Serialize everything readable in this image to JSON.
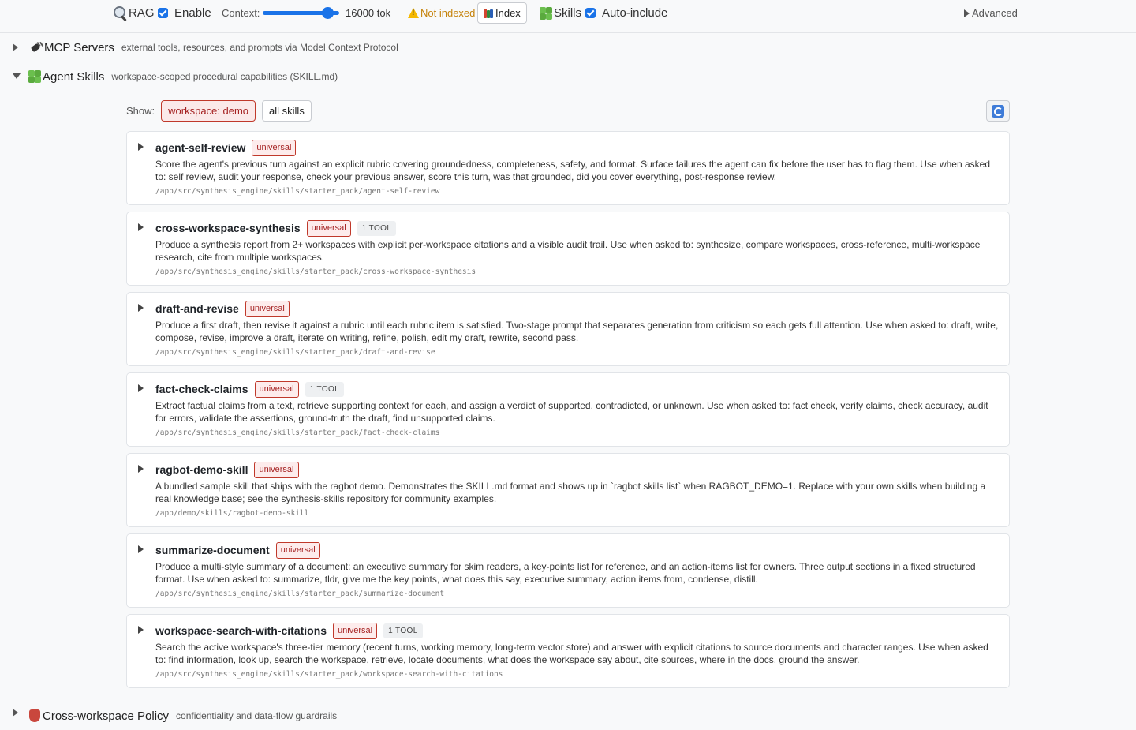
{
  "toolbar": {
    "rag_label": "RAG",
    "enable_label": "Enable",
    "context_label": "Context:",
    "context_value": "16000 tok",
    "context_fraction": 0.85,
    "index_status": "Not indexed",
    "index_button": "Index",
    "skills_label": "Skills",
    "auto_include_label": "Auto-include",
    "advanced_label": "Advanced",
    "enable_checked": true,
    "auto_include_checked": true
  },
  "sections": {
    "mcp": {
      "title": "MCP Servers",
      "desc": "external tools, resources, and prompts via Model Context Protocol",
      "expanded": false
    },
    "skills": {
      "title": "Agent Skills",
      "desc": "workspace-scoped procedural capabilities (SKILL.md)",
      "expanded": true
    },
    "policy": {
      "title": "Cross-workspace Policy",
      "desc": "confidentiality and data-flow guardrails",
      "expanded": false
    }
  },
  "filters": {
    "show_label": "Show:",
    "workspace": "workspace: demo",
    "all": "all skills",
    "active": "workspace"
  },
  "skills": [
    {
      "name": "agent-self-review",
      "badge": "universal",
      "tool": "",
      "desc": "Score the agent's previous turn against an explicit rubric covering groundedness, completeness, safety, and format. Surface failures the agent can fix before the user has to flag them. Use when asked to: self review, audit your response, check your previous answer, score this turn, was that grounded, did you cover everything, post-response review.",
      "path": "/app/src/synthesis_engine/skills/starter_pack/agent-self-review"
    },
    {
      "name": "cross-workspace-synthesis",
      "badge": "universal",
      "tool": "1 TOOL",
      "desc": "Produce a synthesis report from 2+ workspaces with explicit per-workspace citations and a visible audit trail. Use when asked to: synthesize, compare workspaces, cross-reference, multi-workspace research, cite from multiple workspaces.",
      "path": "/app/src/synthesis_engine/skills/starter_pack/cross-workspace-synthesis"
    },
    {
      "name": "draft-and-revise",
      "badge": "universal",
      "tool": "",
      "desc": "Produce a first draft, then revise it against a rubric until each rubric item is satisfied. Two-stage prompt that separates generation from criticism so each gets full attention. Use when asked to: draft, write, compose, revise, improve a draft, iterate on writing, refine, polish, edit my draft, rewrite, second pass.",
      "path": "/app/src/synthesis_engine/skills/starter_pack/draft-and-revise"
    },
    {
      "name": "fact-check-claims",
      "badge": "universal",
      "tool": "1 TOOL",
      "desc": "Extract factual claims from a text, retrieve supporting context for each, and assign a verdict of supported, contradicted, or unknown. Use when asked to: fact check, verify claims, check accuracy, audit for errors, validate the assertions, ground-truth the draft, find unsupported claims.",
      "path": "/app/src/synthesis_engine/skills/starter_pack/fact-check-claims"
    },
    {
      "name": "ragbot-demo-skill",
      "badge": "universal",
      "tool": "",
      "desc": "A bundled sample skill that ships with the ragbot demo. Demonstrates the SKILL.md format and shows up in `ragbot skills list` when RAGBOT_DEMO=1. Replace with your own skills when building a real knowledge base; see the synthesis-skills repository for community examples.",
      "path": "/app/demo/skills/ragbot-demo-skill"
    },
    {
      "name": "summarize-document",
      "badge": "universal",
      "tool": "",
      "desc": "Produce a multi-style summary of a document: an executive summary for skim readers, a key-points list for reference, and an action-items list for owners. Three output sections in a fixed structured format. Use when asked to: summarize, tldr, give me the key points, what does this say, executive summary, action items from, condense, distill.",
      "path": "/app/src/synthesis_engine/skills/starter_pack/summarize-document"
    },
    {
      "name": "workspace-search-with-citations",
      "badge": "universal",
      "tool": "1 TOOL",
      "desc": "Search the active workspace's three-tier memory (recent turns, working memory, long-term vector store) and answer with explicit citations to source documents and character ranges. Use when asked to: find information, look up, search the workspace, retrieve, locate documents, what does the workspace say about, cite sources, where in the docs, ground the answer.",
      "path": "/app/src/synthesis_engine/skills/starter_pack/workspace-search-with-citations"
    }
  ],
  "colors": {
    "accent": "#1a73e8",
    "badge_border": "#c0392b",
    "badge_text": "#a52222",
    "warning": "#c5820a"
  }
}
